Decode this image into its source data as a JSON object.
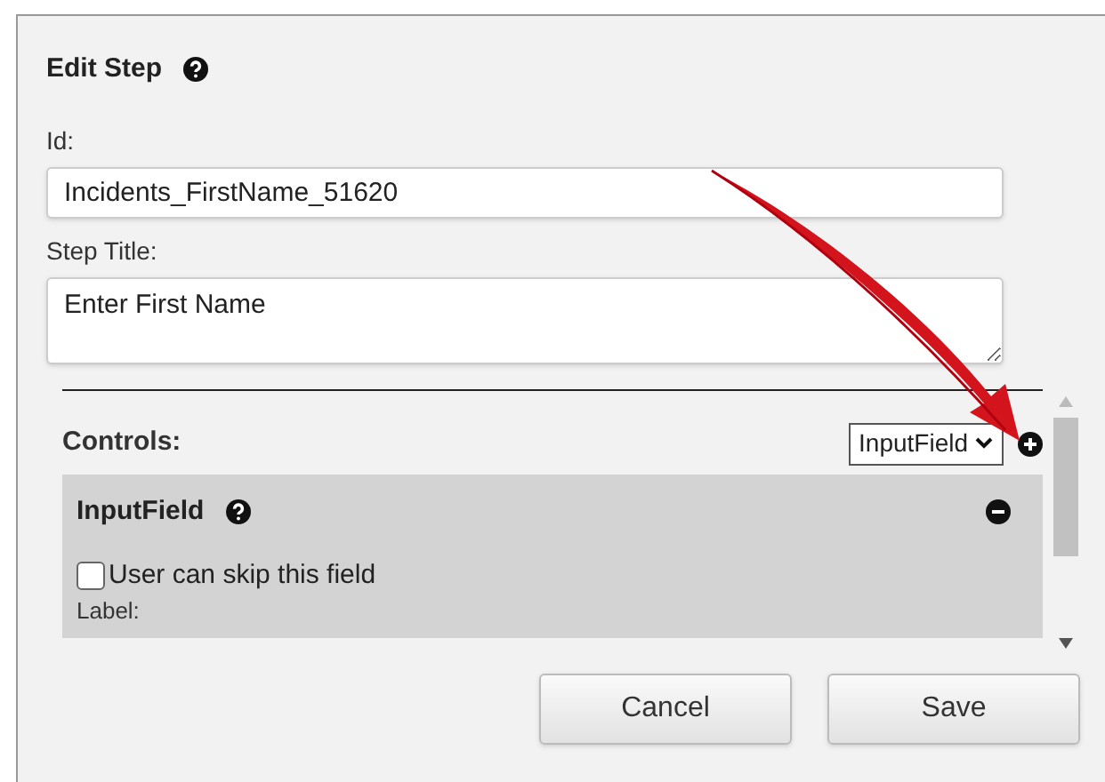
{
  "dialog": {
    "title": "Edit Step",
    "fields": [
      {
        "label": "Id:",
        "kind": "input",
        "value": "Incidents_FirstName_51620"
      },
      {
        "label": "Step Title:",
        "kind": "textarea",
        "value": "Enter First Name"
      }
    ],
    "controls": {
      "label": "Controls:",
      "select": "InputField",
      "items": [
        {
          "title": "InputField",
          "skip_label": "User can skip this field",
          "checked": false,
          "next_label": "Label:"
        }
      ]
    },
    "buttons": [
      "Cancel",
      "Save"
    ]
  }
}
